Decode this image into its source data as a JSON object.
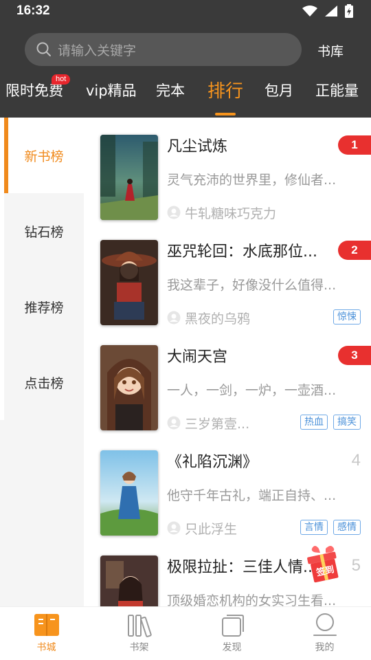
{
  "status_bar": {
    "time": "16:32"
  },
  "search": {
    "placeholder": "请输入关键字"
  },
  "header": {
    "library_label": "书库"
  },
  "tabs": [
    {
      "label": "限时免费",
      "badge": "hot"
    },
    {
      "label": "vip精品"
    },
    {
      "label": "完本"
    },
    {
      "label": "排行",
      "active": true
    },
    {
      "label": "包月"
    },
    {
      "label": "正能量"
    }
  ],
  "sidebar": {
    "items": [
      {
        "label": "新书榜",
        "active": true
      },
      {
        "label": "钻石榜"
      },
      {
        "label": "推荐榜"
      },
      {
        "label": "点击榜"
      }
    ]
  },
  "books": [
    {
      "rank": "1",
      "title": "凡尘试炼",
      "desc": "灵气充沛的世界里，修仙者...",
      "author": "牛轧糖味巧克力",
      "tags": []
    },
    {
      "rank": "2",
      "title": "巫咒轮回：水底那位...",
      "desc": "我这辈子，好像没什么值得...",
      "author": "黑夜的乌鸦",
      "tags": [
        "惊悚"
      ]
    },
    {
      "rank": "3",
      "title": "大闹天宫",
      "desc": "一人，一剑，一炉，一壶酒...",
      "author": "三岁第壹...",
      "tags": [
        "热血",
        "搞笑"
      ]
    },
    {
      "rank": "4",
      "title": "《礼陷沉渊》",
      "desc": "他守千年古礼，端正自持、...",
      "author": "只此浮生",
      "tags": [
        "言情",
        "感情"
      ]
    },
    {
      "rank": "5",
      "title": "极限拉扯：三佳人情...",
      "desc": "顶级婚恋机构的女实习生看...",
      "author": "",
      "tags": []
    }
  ],
  "checkin": {
    "label": "签到"
  },
  "bottom_nav": [
    {
      "label": "书城",
      "active": true
    },
    {
      "label": "书架"
    },
    {
      "label": "发现"
    },
    {
      "label": "我的"
    }
  ],
  "colors": {
    "accent": "#f08a1c",
    "header_bg": "#3a3a3a",
    "rank_badge": "#e8302f",
    "tag": "#4a90d9"
  }
}
